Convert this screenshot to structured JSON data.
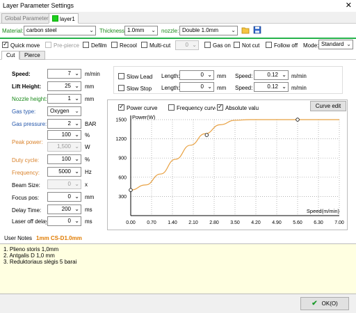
{
  "window": {
    "title": "Layer Parameter Settings",
    "close": "✕"
  },
  "tabs": [
    {
      "label": "Global Parameter"
    },
    {
      "label": "layer1"
    }
  ],
  "toolbar": {
    "material_label": "Material:",
    "material_value": "carbon steel",
    "thickness_label": "Thickness:",
    "thickness_value": "1.0mm",
    "nozzle_label": "nozzle:",
    "nozzle_value": "Double 1.0mm"
  },
  "options": {
    "quick_move": "Quick move",
    "pre_pierce": "Pre-pierce",
    "defilm": "Defilm",
    "recool": "Recool",
    "multi_cut": "Multi-cut",
    "multi_cut_value": "0",
    "gas_on": "Gas on",
    "not_cut": "Not cut",
    "follow_off": "Follow off",
    "mode_label": "Mode:",
    "mode_value": "Standard"
  },
  "subtabs": [
    {
      "label": "Cut"
    },
    {
      "label": "Pierce"
    }
  ],
  "params": {
    "speed": {
      "label": "Speed:",
      "value": "7",
      "unit": "m/min"
    },
    "lift_height": {
      "label": "Lift Height:",
      "value": "25",
      "unit": "mm"
    },
    "nozzle_height": {
      "label": "Nozzle height:",
      "value": "1",
      "unit": "mm"
    },
    "gas_type": {
      "label": "Gas type:",
      "value": "Oxygen"
    },
    "gas_pressure": {
      "label": "Gas pressure:",
      "value": "2",
      "unit": "BAR"
    },
    "power_percent": {
      "value": "100",
      "unit": "%"
    },
    "peak_power": {
      "label": "Peak power:",
      "value": "1,500",
      "unit": "W"
    },
    "duty_cycle": {
      "label": "Duty cycle:",
      "value": "100",
      "unit": "%"
    },
    "frequency": {
      "label": "Frequency:",
      "value": "5000",
      "unit": "Hz"
    },
    "beam_size": {
      "label": "Beam Size:",
      "value": "0",
      "unit": "x"
    },
    "focus_pos": {
      "label": "Focus pos:",
      "value": "0",
      "unit": "mm"
    },
    "delay_time": {
      "label": "Delay Time:",
      "value": "200",
      "unit": "ms"
    },
    "laser_off_delay": {
      "label": "Laser off delay",
      "value": "0",
      "unit": "ms"
    }
  },
  "slow": {
    "slow_lead": "Slow Lead",
    "slow_stop": "Slow Stop",
    "length_label": "Length:",
    "length1": "0",
    "length2": "0",
    "length_unit": "mm",
    "speed_label": "Speed:",
    "speed1": "0.12",
    "speed2": "0.12",
    "speed_unit": "m/min"
  },
  "chart_options": {
    "power_curve": "Power curve",
    "frequency_curve": "Frequency curve",
    "absolute_value": "Absolute valu",
    "curve_edit": "Curve edit"
  },
  "chart_data": {
    "type": "line",
    "ylabel": "Power(W)",
    "xlabel": "Speed(m/min)",
    "xlim": [
      0,
      7
    ],
    "ylim": [
      0,
      1500
    ],
    "x_ticks": [
      "0.00",
      "0.70",
      "1.40",
      "2.10",
      "2.80",
      "3.50",
      "4.20",
      "4.90",
      "5.60",
      "6.30",
      "7.00"
    ],
    "y_ticks": [
      "300",
      "600",
      "900",
      "1200",
      "1500"
    ],
    "series": [
      {
        "x": [
          0,
          0.5,
          1.0,
          1.5,
          2.0,
          2.5,
          3.0,
          3.5,
          4.0,
          5.0,
          6.0,
          7.0
        ],
        "y": [
          400,
          480,
          650,
          880,
          1100,
          1280,
          1420,
          1490,
          1500,
          1500,
          1500,
          1500
        ]
      }
    ],
    "control_points": [
      {
        "x": 0,
        "y": 400
      },
      {
        "x": 2.55,
        "y": 1260
      },
      {
        "x": 5.6,
        "y": 1500
      }
    ],
    "line_color": "#e8a040"
  },
  "notes": {
    "label": "User Notes",
    "title": "1mm CS-D1.0mm",
    "lines": [
      "1. Plieno storis 1,0mm",
      "2. Antgalis  D 1,0 mm",
      "3. Reduktoriaus slėgis 5 barai"
    ]
  },
  "footer": {
    "ok": "OK(O)"
  }
}
